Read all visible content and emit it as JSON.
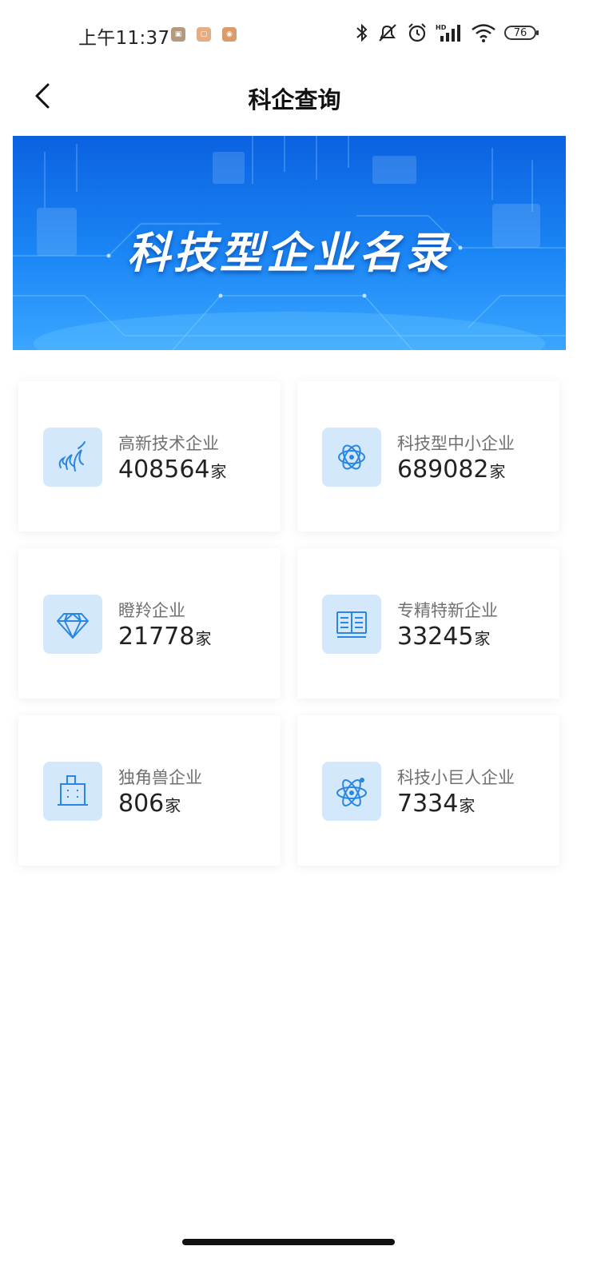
{
  "status_bar": {
    "time": "上午11:37",
    "battery": "76"
  },
  "nav": {
    "title": "科企查询"
  },
  "banner": {
    "title": "科技型企业名录"
  },
  "unit": "家",
  "cards": [
    {
      "label": "高新技术企业",
      "count": "408564",
      "icon": "flame-icon"
    },
    {
      "label": "科技型中小企业",
      "count": "689082",
      "icon": "atom-icon"
    },
    {
      "label": "瞪羚企业",
      "count": "21778",
      "icon": "diamond-icon"
    },
    {
      "label": "专精特新企业",
      "count": "33245",
      "icon": "book-icon"
    },
    {
      "label": "独角兽企业",
      "count": "806",
      "icon": "building-icon"
    },
    {
      "label": "科技小巨人企业",
      "count": "7334",
      "icon": "atom-orbit-icon"
    }
  ],
  "colors": {
    "accent": "#2a86e0",
    "icon_bg": "#d3e8fb",
    "banner": "#1b86f5"
  }
}
